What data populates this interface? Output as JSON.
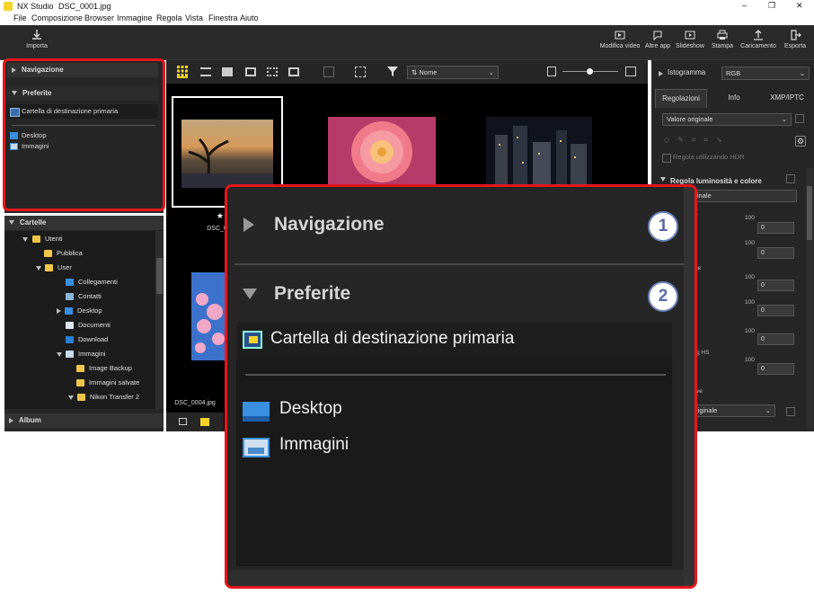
{
  "window": {
    "app_name": "NX Studio",
    "file_name": "DSC_0001.jpg",
    "controls": {
      "minimize": "–",
      "maximize": "❐",
      "close": "✕"
    }
  },
  "menu": [
    "File",
    "Composizione",
    "Browser",
    "Immagine",
    "Regola",
    "Vista",
    "Finestra",
    "Aiuto"
  ],
  "toolbar": {
    "import_label": "Importa",
    "actions": [
      "Modifica video",
      "Altre app",
      "Slideshow",
      "Stampa",
      "Caricamento",
      "Esporta"
    ]
  },
  "left_panel": {
    "navigation_label": "Navigazione",
    "favorites_label": "Preferite",
    "favorites": {
      "primary": "Cartella di destinazione primaria",
      "items": [
        "Desktop",
        "Immagini"
      ]
    },
    "folders_label": "Cartelle",
    "folder_tree": [
      "Utenti",
      "Pubblica",
      "User",
      "Collegamenti",
      "Contatti",
      "Desktop",
      "Documenti",
      "Download",
      "Immagini",
      "Image Backup",
      "Immagini salvate",
      "Nikon Transfer 2"
    ],
    "album_label": "Album"
  },
  "browser": {
    "sort_label": "Nome",
    "thumbs": [
      {
        "stars": "★★★",
        "name": "DSC_0001.jpg"
      },
      {
        "stars": "",
        "name": "DSC_0004.jpg"
      }
    ]
  },
  "right_panel": {
    "histogram_label": "Istogramma",
    "histogram_channel": "RGB",
    "tabs": [
      "Regolazioni",
      "Info",
      "XMP/IPTC"
    ],
    "preset_value": "Valore originale",
    "hdr_label": "Regola utilizzando HDR",
    "section_label": "Regola luminosità e colore",
    "section_value_partial": "iginale",
    "slider_max": "100",
    "slider_value": "0",
    "partial_labels": [
      "à",
      "ne",
      "g HS",
      "ve"
    ],
    "second_value_partial": "originale"
  },
  "callout": {
    "navigation_label": "Navigazione",
    "favorites_label": "Preferite",
    "primary_label": "Cartella di destinazione primaria",
    "items": [
      "Desktop",
      "Immagini"
    ],
    "badges": [
      "1",
      "2"
    ]
  },
  "colors": {
    "highlight": "#e5161c",
    "panel": "#262626",
    "accent_yellow": "#f5d328",
    "badge": "#5a6aa8"
  }
}
